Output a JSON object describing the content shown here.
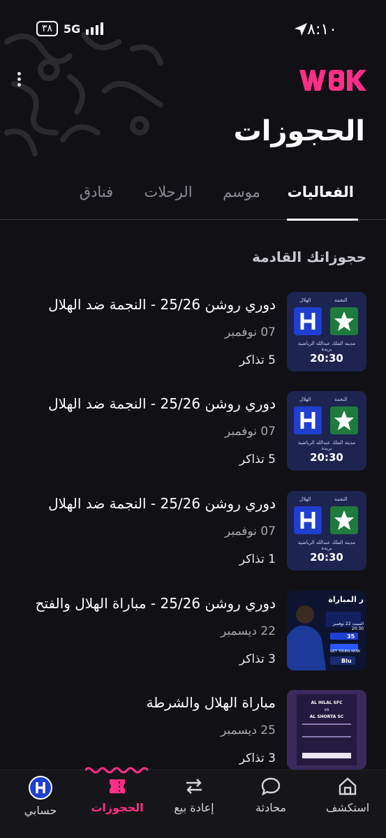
{
  "status": {
    "time": "٨:١٠",
    "battery": "٣٨",
    "network": "5G"
  },
  "header": {
    "logo_text": "WBK",
    "title": "الحجوزات"
  },
  "tabs": [
    "الفعاليات",
    "موسم",
    "الرحلات",
    "فنادق"
  ],
  "section": {
    "title": "حجوزاتك القادمة"
  },
  "bookings": [
    {
      "name": "دوري روشن 25/26 - النجمة  ضد الهلال",
      "date": "07 نوفمبر",
      "tickets": "5 تذاكر",
      "thumb": {
        "home": "الهلال",
        "away": "النجمة",
        "venue": "مدينة الملك عبدالله الرياضية",
        "city": "بريدة",
        "time": "20:30"
      }
    },
    {
      "name": "دوري روشن 25/26 - النجمة  ضد الهلال",
      "date": "07 نوفمبر",
      "tickets": "5 تذاكر",
      "thumb": {
        "home": "الهلال",
        "away": "النجمة",
        "venue": "مدينة الملك عبدالله الرياضية",
        "city": "بريدة",
        "time": "20:30"
      }
    },
    {
      "name": "دوري روشن 25/26 - النجمة  ضد الهلال",
      "date": "07 نوفمبر",
      "tickets": "1 تذاكر",
      "thumb": {
        "home": "الهلال",
        "away": "النجمة",
        "venue": "مدينة الملك عبدالله الرياضية",
        "city": "بريدة",
        "time": "20:30"
      }
    },
    {
      "name": "دوري روشن 25/26 - مباراة الهلال والفتح",
      "date": "22 ديسمبر",
      "tickets": "3 تذاكر",
      "thumb": {
        "headline": "ر المباراة",
        "date_line": "السبت 22 نوفمبر 20:30",
        "price": "35",
        "cta": "GET YOURS NOW",
        "brand": "Blu"
      }
    },
    {
      "name": "مباراة الهلال والشرطة",
      "date": "25 ديسمبر",
      "tickets": "3 تذاكر",
      "thumb": {
        "team_a": "AL HILAL SFC",
        "vs": "vs",
        "team_b": "AL SHORTA SC"
      }
    }
  ],
  "bottom_nav": [
    {
      "label": "استكشف",
      "icon": "home-icon"
    },
    {
      "label": "محادثة",
      "icon": "chat-icon"
    },
    {
      "label": "إعادة بيع",
      "icon": "resale-icon"
    },
    {
      "label": "الحجوزات",
      "icon": "ticket-icon",
      "active": true
    },
    {
      "label": "حسابي",
      "icon": "avatar-icon"
    }
  ],
  "colors": {
    "accent": "#ff2e86",
    "background": "#111014",
    "hilal_blue": "#1f3fd0",
    "najma_green": "#1f7a3e"
  }
}
